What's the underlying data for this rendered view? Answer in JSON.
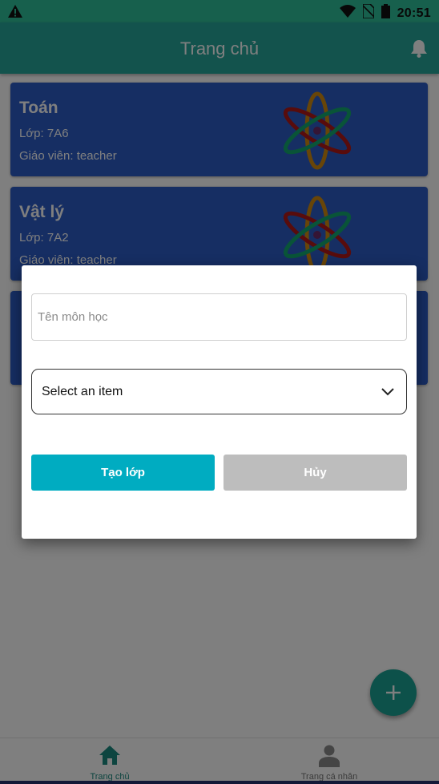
{
  "status_bar": {
    "time": "20:51",
    "icons": [
      "warning-icon",
      "wifi-icon",
      "no-sim-icon",
      "battery-icon"
    ]
  },
  "app_bar": {
    "title": "Trang chủ",
    "icon": "bell-icon"
  },
  "classes": [
    {
      "subject": "Toán",
      "class_label": "Lớp: 7A6",
      "teacher_label": "Giáo viên: teacher"
    },
    {
      "subject": "Vật lý",
      "class_label": "Lớp: 7A2",
      "teacher_label": "Giáo viên: teacher"
    },
    {
      "subject": "",
      "class_label": "",
      "teacher_label": ""
    }
  ],
  "dialog": {
    "subject_input": {
      "placeholder": "Tên môn học",
      "value": ""
    },
    "select": {
      "value": "Select an item"
    },
    "create_button": "Tạo lớp",
    "cancel_button": "Hủy"
  },
  "fab": {
    "icon": "plus-icon"
  },
  "bottom_nav": {
    "items": [
      {
        "label": "Trang chủ",
        "icon": "home-icon",
        "active": true
      },
      {
        "label": "Trang cá nhân",
        "icon": "person-icon",
        "active": false
      }
    ]
  },
  "colors": {
    "status_bar": "#2fc09a",
    "app_bar": "#26a69a",
    "card": "#2d5dc6",
    "fab": "#1aa394",
    "create_button": "#00acc1",
    "cancel_button": "#bdbdbd",
    "nav_active": "#1a8a80"
  }
}
